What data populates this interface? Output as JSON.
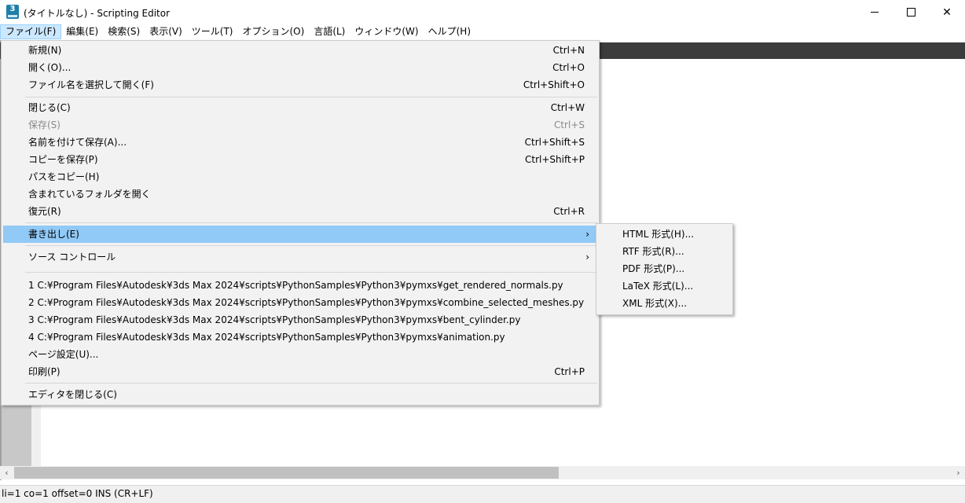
{
  "window": {
    "title": "(タイトルなし) - Scripting Editor",
    "icon_label": "3",
    "controls": {
      "minimize": "minimize-icon",
      "maximize": "maximize-icon",
      "close": "✕"
    }
  },
  "menubar": {
    "items": [
      "ファイル(F)",
      "編集(E)",
      "検索(S)",
      "表示(V)",
      "ツール(T)",
      "オプション(O)",
      "言語(L)",
      "ウィンドウ(W)",
      "ヘルプ(H)"
    ]
  },
  "file_menu": {
    "new": {
      "label": "新規(N)",
      "shortcut": "Ctrl+N"
    },
    "open": {
      "label": "開く(O)...",
      "shortcut": "Ctrl+O"
    },
    "open_selected": {
      "label": "ファイル名を選択して開く(F)",
      "shortcut": "Ctrl+Shift+O"
    },
    "close": {
      "label": "閉じる(C)",
      "shortcut": "Ctrl+W"
    },
    "save": {
      "label": "保存(S)",
      "shortcut": "Ctrl+S"
    },
    "save_as": {
      "label": "名前を付けて保存(A)...",
      "shortcut": "Ctrl+Shift+S"
    },
    "save_copy": {
      "label": "コピーを保存(P)",
      "shortcut": "Ctrl+Shift+P"
    },
    "copy_path": {
      "label": "パスをコピー(H)"
    },
    "open_folder": {
      "label": "含まれているフォルダを開く"
    },
    "revert": {
      "label": "復元(R)",
      "shortcut": "Ctrl+R"
    },
    "export": {
      "label": "書き出し(E)",
      "arrow": "›"
    },
    "source_control": {
      "label": "ソース コントロール",
      "arrow": "›"
    },
    "recent": [
      "1 C:¥Program Files¥Autodesk¥3ds Max 2024¥scripts¥PythonSamples¥Python3¥pymxs¥get_rendered_normals.py",
      "2 C:¥Program Files¥Autodesk¥3ds Max 2024¥scripts¥PythonSamples¥Python3¥pymxs¥combine_selected_meshes.py",
      "3 C:¥Program Files¥Autodesk¥3ds Max 2024¥scripts¥PythonSamples¥Python3¥pymxs¥bent_cylinder.py",
      "4 C:¥Program Files¥Autodesk¥3ds Max 2024¥scripts¥PythonSamples¥Python3¥pymxs¥animation.py"
    ],
    "page_setup": {
      "label": "ページ設定(U)..."
    },
    "print": {
      "label": "印刷(P)",
      "shortcut": "Ctrl+P"
    },
    "exit": {
      "label": "エディタを閉じる(C)"
    }
  },
  "export_submenu": [
    "HTML 形式(H)...",
    "RTF 形式(R)...",
    "PDF 形式(P)...",
    "LaTeX 形式(L)...",
    "XML 形式(X)..."
  ],
  "scrollbar": {
    "left_arrow": "‹",
    "right_arrow": "›"
  },
  "status": {
    "text": "li=1 co=1 offset=0 INS (CR+LF)"
  }
}
